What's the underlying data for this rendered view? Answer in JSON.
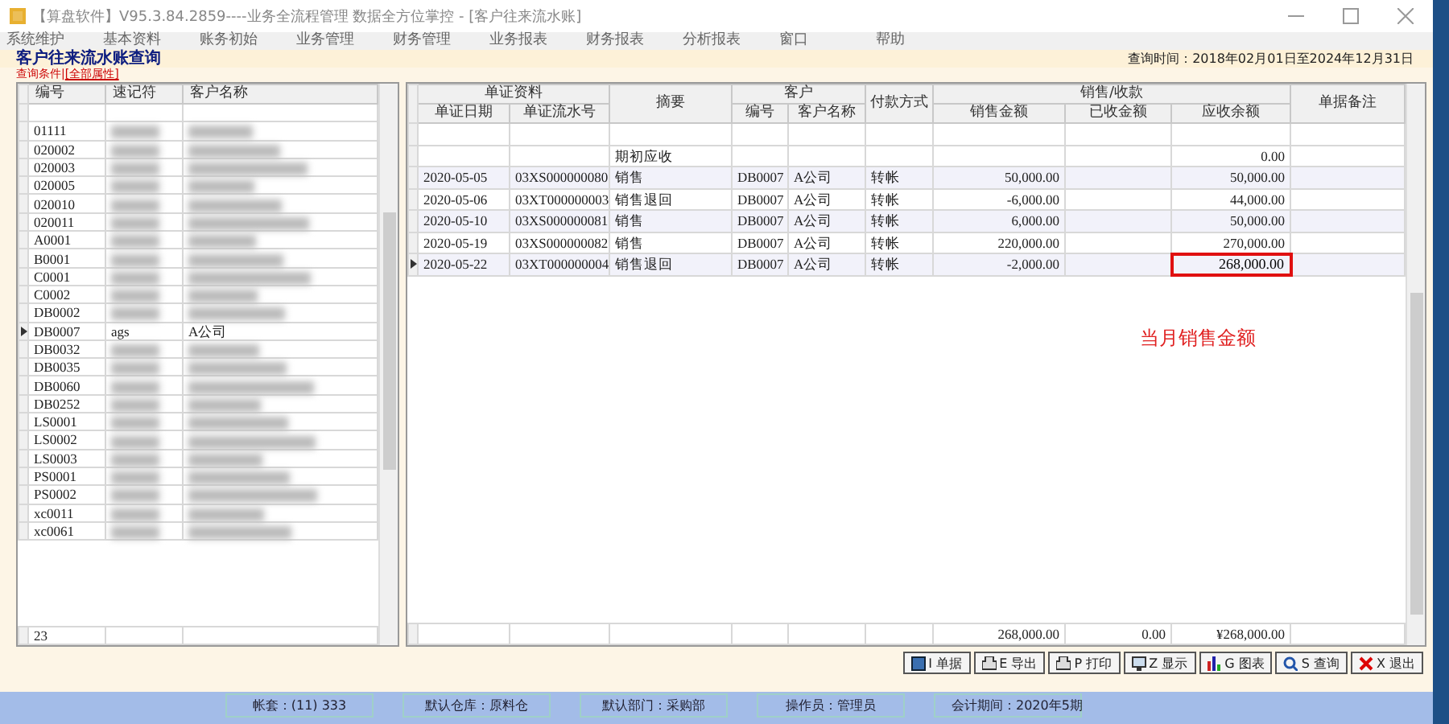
{
  "window": {
    "title": "【算盘软件】V95.3.84.2859----业务全流程管理 数据全方位掌控 - [客户往来流水账]"
  },
  "menu": [
    "系统维护",
    "基本资料",
    "账务初始",
    "业务管理",
    "财务管理",
    "业务报表",
    "财务报表",
    "分析报表",
    "窗口",
    "帮助"
  ],
  "page_title": "客户往来流水账查询",
  "query_time": "查询时间：2018年02月01日至2024年12月31日",
  "condition": {
    "label": "查询条件|",
    "link": "[全部属性]"
  },
  "customer_list": {
    "columns": [
      "编号",
      "速记符",
      "客户名称"
    ],
    "rows": [
      {
        "code": "01111",
        "redacted": true,
        "selected": false
      },
      {
        "code": "020002",
        "redacted": true,
        "selected": false
      },
      {
        "code": "020003",
        "redacted": true,
        "selected": false
      },
      {
        "code": "020005",
        "redacted": true,
        "selected": false
      },
      {
        "code": "020010",
        "redacted": true,
        "selected": false
      },
      {
        "code": "020011",
        "redacted": true,
        "selected": false
      },
      {
        "code": "A0001",
        "redacted": true,
        "selected": false
      },
      {
        "code": "B0001",
        "redacted": true,
        "selected": false
      },
      {
        "code": "C0001",
        "redacted": true,
        "selected": false
      },
      {
        "code": "C0002",
        "redacted": true,
        "selected": false
      },
      {
        "code": "DB0002",
        "redacted": true,
        "selected": false
      },
      {
        "code": "DB0007",
        "shorthand": "ags",
        "name": "A公司",
        "redacted": false,
        "selected": true
      },
      {
        "code": "DB0032",
        "redacted": true,
        "selected": false
      },
      {
        "code": "DB0035",
        "redacted": true,
        "selected": false
      },
      {
        "code": "DB0060",
        "redacted": true,
        "selected": false
      },
      {
        "code": "DB0252",
        "redacted": true,
        "selected": false
      },
      {
        "code": "LS0001",
        "redacted": true,
        "selected": false
      },
      {
        "code": "LS0002",
        "redacted": true,
        "selected": false
      },
      {
        "code": "LS0003",
        "redacted": true,
        "selected": false
      },
      {
        "code": "PS0001",
        "redacted": true,
        "selected": false
      },
      {
        "code": "PS0002",
        "redacted": true,
        "selected": false
      },
      {
        "code": "xc0011",
        "redacted": true,
        "selected": false
      },
      {
        "code": "xc0061",
        "redacted": true,
        "selected": false
      }
    ],
    "footer": "23"
  },
  "ledger": {
    "groups": [
      {
        "label": "单证资料",
        "columns": [
          "单证日期",
          "单证流水号"
        ]
      },
      {
        "label": "摘要"
      },
      {
        "label": "客户",
        "columns": [
          "编号",
          "客户名称"
        ]
      },
      {
        "label": "付款方式"
      },
      {
        "label": "销售/收款",
        "columns": [
          "销售金额",
          "已收金额",
          "应收余额"
        ]
      },
      {
        "label": "单据备注"
      }
    ],
    "rows": [
      {
        "date": "",
        "voucher": "",
        "summary": "期初应收",
        "code": "",
        "customer": "",
        "payment": "",
        "sales": "",
        "received": "",
        "balance": "0.00",
        "selected": false,
        "highlighted": false
      },
      {
        "date": "2020-05-05",
        "voucher": "03XS000000080",
        "summary": "销售",
        "code": "DB0007",
        "customer": "A公司",
        "payment": "转帐",
        "sales": "50,000.00",
        "received": "",
        "balance": "50,000.00",
        "selected": false,
        "highlighted": false
      },
      {
        "date": "2020-05-06",
        "voucher": "03XT000000003",
        "summary": "销售退回",
        "code": "DB0007",
        "customer": "A公司",
        "payment": "转帐",
        "sales": "-6,000.00",
        "received": "",
        "balance": "44,000.00",
        "selected": false,
        "highlighted": false
      },
      {
        "date": "2020-05-10",
        "voucher": "03XS000000081",
        "summary": "销售",
        "code": "DB0007",
        "customer": "A公司",
        "payment": "转帐",
        "sales": "6,000.00",
        "received": "",
        "balance": "50,000.00",
        "selected": false,
        "highlighted": false
      },
      {
        "date": "2020-05-19",
        "voucher": "03XS000000082",
        "summary": "销售",
        "code": "DB0007",
        "customer": "A公司",
        "payment": "转帐",
        "sales": "220,000.00",
        "received": "",
        "balance": "270,000.00",
        "selected": false,
        "highlighted": false
      },
      {
        "date": "2020-05-22",
        "voucher": "03XT000000004",
        "summary": "销售退回",
        "code": "DB0007",
        "customer": "A公司",
        "payment": "转帐",
        "sales": "-2,000.00",
        "received": "",
        "balance": "268,000.00",
        "selected": true,
        "highlighted": true
      }
    ],
    "totals": {
      "sales": "268,000.00",
      "received": "0.00",
      "balance": "¥268,000.00"
    },
    "annotation": "当月销售金额"
  },
  "buttons": [
    {
      "kind": "document",
      "key": "I",
      "label": "单据"
    },
    {
      "kind": "export",
      "key": "E",
      "label": "导出"
    },
    {
      "kind": "print",
      "key": "P",
      "label": "打印"
    },
    {
      "kind": "display",
      "key": "Z",
      "label": "显示"
    },
    {
      "kind": "chart",
      "key": "G",
      "label": "图表"
    },
    {
      "kind": "query",
      "key": "S",
      "label": "查询"
    },
    {
      "kind": "exit",
      "key": "X",
      "label": "退出"
    }
  ],
  "status_bar": [
    "帐套：(11) 333",
    "默认仓库：原料仓",
    "默认部门：采购部",
    "操作员：管理员",
    "会计期间：2020年5期"
  ]
}
